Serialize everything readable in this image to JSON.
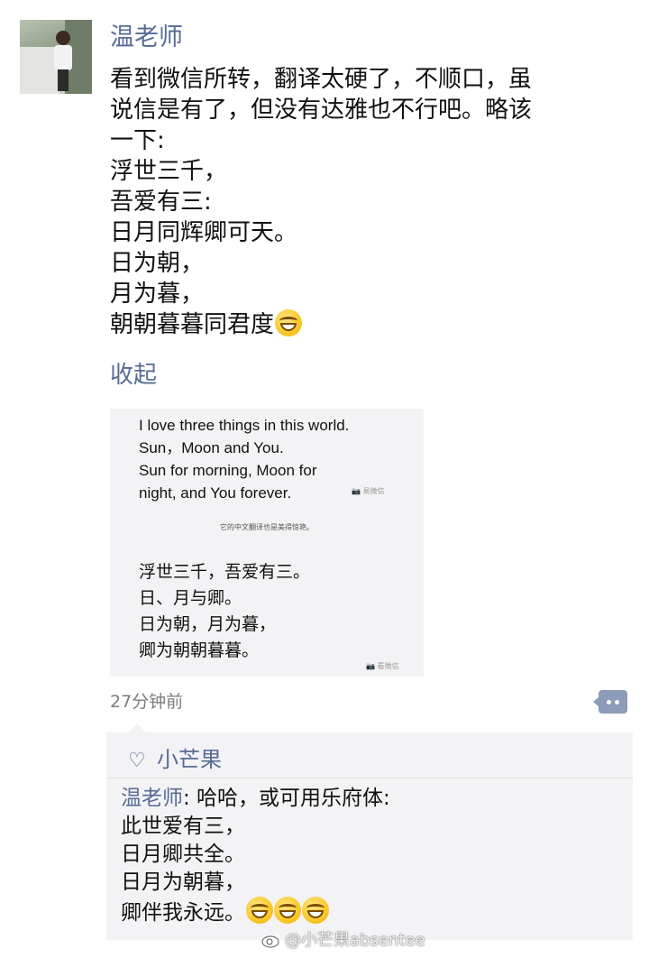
{
  "post": {
    "author": "温老师",
    "lines": [
      "看到微信所转，翻译太硬了，不顺口，虽",
      "说信是有了，但没有达雅也不行吧。略该",
      "一下:",
      "浮世三千，",
      "吾爱有三:",
      "日月同辉卿可天。",
      "日为朝，",
      "月为暮，",
      "朝朝暮暮同君度"
    ],
    "emoji": "grinning-emoji",
    "collapse_label": "收起",
    "time": "27分钟前"
  },
  "image": {
    "english_lines": [
      "I love three things in this world.",
      "Sun，Moon and You.",
      "Sun for morning, Moon for",
      "night, and You forever."
    ],
    "small_caption": "它的中文翻译也是美得惊艳。",
    "chinese_lines": [
      "浮世三千，吾爱有三。",
      "日、月与卿。",
      "日为朝，月为暮，",
      "卿为朝朝暮暮。"
    ],
    "watermark_1": "📷 易微信",
    "watermark_2": "📷 看微信"
  },
  "interactions": {
    "liker": "小芒果",
    "reply_author": "温老师",
    "reply_first": ": 哈哈，或可用乐府体:",
    "reply_lines": [
      "此世爱有三，",
      "日月卿共全。",
      "日月为朝暮，",
      "卿伴我永远。"
    ],
    "reply_emoji_count": 3
  },
  "watermark": {
    "text": "@小芒果absentee"
  },
  "colors": {
    "link": "#576b95",
    "panel": "#f3f3f5",
    "comment_button": "#8b9bb8"
  }
}
